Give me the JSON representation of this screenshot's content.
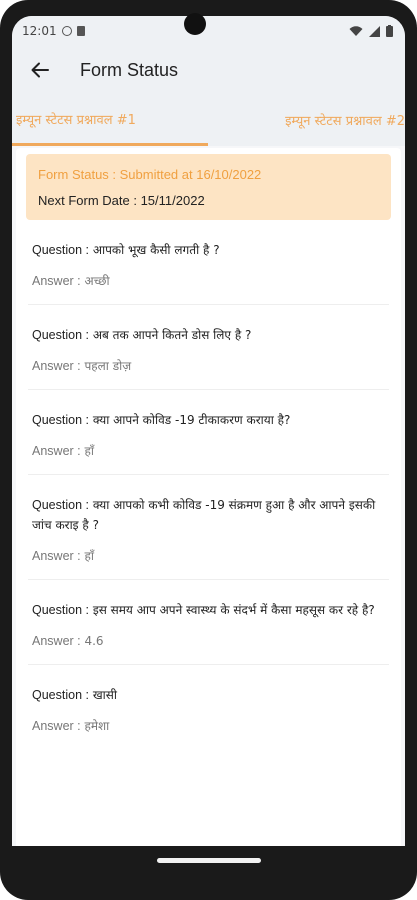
{
  "status_bar": {
    "time": "12:01"
  },
  "app_bar": {
    "title": "Form Status"
  },
  "tabs": [
    {
      "label": "इम्यून स्टेटस प्रश्नावल #1",
      "active": true
    },
    {
      "label": "इम्यून स्टेटस प्रश्नावल #2",
      "active": false
    }
  ],
  "banner": {
    "status": "Form Status : Submitted at 16/10/2022",
    "next": "Next Form Date : 15/11/2022"
  },
  "labels": {
    "question": "Question :",
    "answer": "Answer :"
  },
  "items": [
    {
      "question": "आपको भूख कैसी लगती है ?",
      "answer": "अच्छी"
    },
    {
      "question": "अब तक आपने कितने डोस लिए है ?",
      "answer": "पहला डोज़"
    },
    {
      "question": "क्या आपने कोविड -19 टीकाकरण कराया है?",
      "answer": "हाँ"
    },
    {
      "question": "क्या आपको कभी कोविड -19 संक्रमण हुआ है और आपने इसकी जांच कराइ है ?",
      "answer": "हाँ"
    },
    {
      "question": "इस समय आप अपने स्वास्थ्य के संदर्भ में कैसा महसूस कर रहे है?",
      "answer": "4.6"
    },
    {
      "question": "खासी",
      "answer": "हमेशा"
    }
  ],
  "colors": {
    "accent": "#f0a95c",
    "banner_bg": "#fde4c4"
  }
}
